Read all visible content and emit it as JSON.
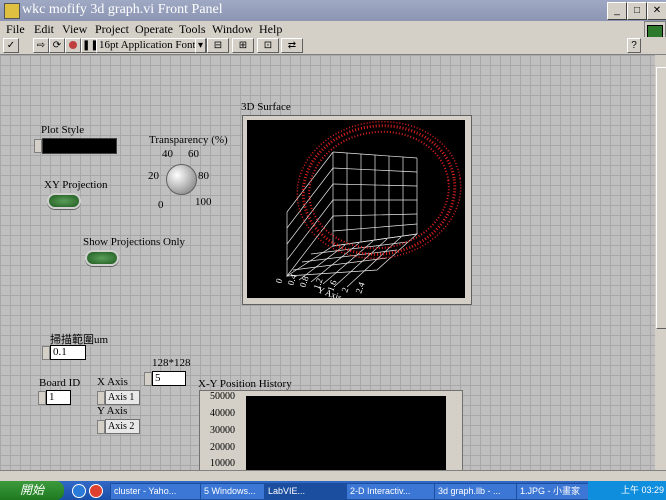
{
  "window": {
    "title": "wkc mofify 3d graph.vi Front Panel"
  },
  "menu": [
    "File",
    "Edit",
    "View",
    "Project",
    "Operate",
    "Tools",
    "Window",
    "Help"
  ],
  "toolbar": {
    "font": "16pt Application Font"
  },
  "controls": {
    "plot_style": "Plot Style",
    "transparency_label": "Transparency (%)",
    "knob_ticks": [
      "0",
      "20",
      "40",
      "60",
      "80",
      "100"
    ],
    "xy_projection": "XY Projection",
    "show_projections": "Show Projections Only",
    "scan_range_label": "掃描範圍um",
    "scan_range_value": "0.1",
    "resolution_label": "128*128",
    "resolution_value": "5",
    "board_id_label": "Board ID",
    "board_id_value": "1",
    "x_axis_label": "X Axis",
    "x_axis_value": "Axis 1",
    "y_axis_label": "Y Axis",
    "y_axis_value": "Axis 2"
  },
  "graph3d": {
    "label": "3D Surface",
    "axis_label": "Y Axis",
    "ticks": [
      "0",
      "0.4",
      "0.8",
      "1.2",
      "1.6",
      "2",
      "2.4"
    ]
  },
  "history": {
    "label": "X-Y Position History",
    "yticks": [
      "50000",
      "40000",
      "30000",
      "20000",
      "10000"
    ]
  },
  "taskbar": {
    "start": "開始",
    "tasks": [
      "cluster - Yaho...",
      "5 Windows...",
      "LabVIE...",
      "2-D Interactiv...",
      "3d graph.llb - ...",
      "1.JPG - 小畫家"
    ],
    "clock": "上午 03:29"
  }
}
